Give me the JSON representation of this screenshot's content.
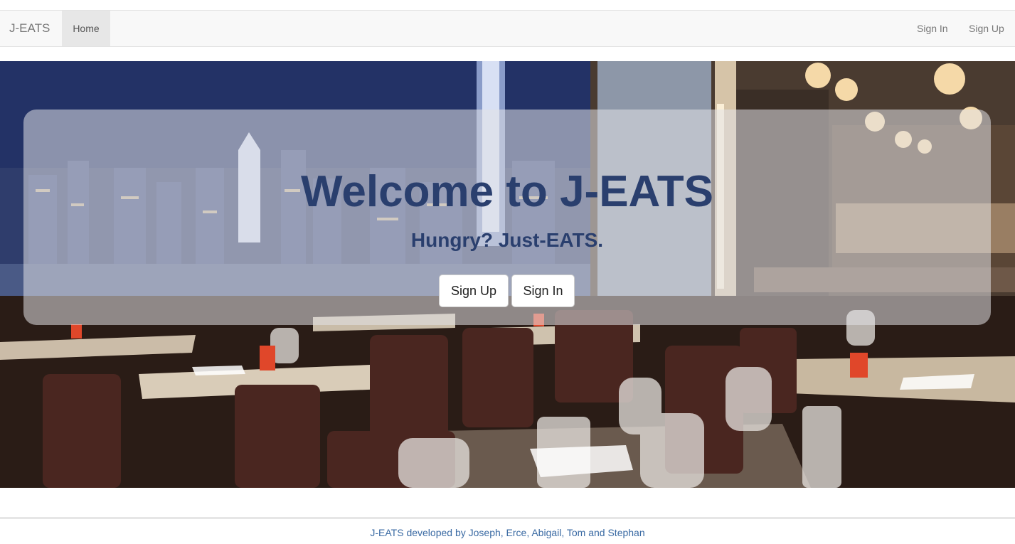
{
  "navbar": {
    "brand": "J-EATS",
    "home_label": "Home",
    "sign_in_label": "Sign In",
    "sign_up_label": "Sign Up"
  },
  "hero": {
    "background_image": "restaurant-harbor-view-photo",
    "title": "Welcome to J-EATS",
    "tagline": "Hungry? Just-EATS.",
    "sign_up_button": "Sign Up",
    "sign_in_button": "Sign In"
  },
  "footer": {
    "credits": "J-EATS developed by Joseph, Erce, Abigail, Tom and Stephan"
  },
  "colors": {
    "heading": "#2a3f6e",
    "footer_link": "#3a6aa3",
    "navbar_bg": "#f8f8f8",
    "active_nav_bg": "#e7e7e7"
  }
}
